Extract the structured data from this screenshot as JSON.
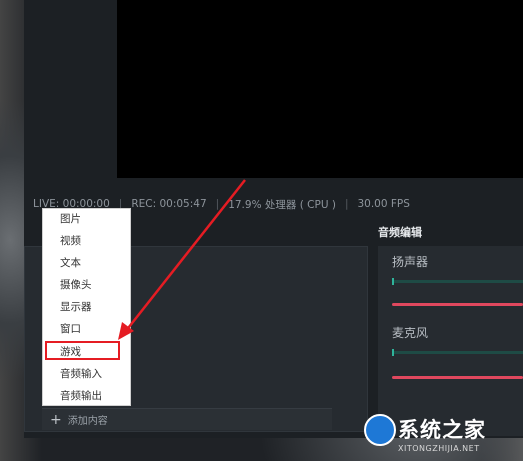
{
  "statusbar": {
    "live": "LIVE: 00:00:00",
    "rec": "REC: 00:05:47",
    "cpu": "17.9% 处理器 ( CPU )",
    "fps": "30.00 FPS"
  },
  "source_menu": {
    "items": [
      "图片",
      "视频",
      "文本",
      "摄像头",
      "显示器",
      "窗口",
      "游戏",
      "音频输入",
      "音频输出"
    ],
    "highlighted": "游戏"
  },
  "add_bar": {
    "icon": "plus-icon",
    "label": "添加内容"
  },
  "audio_panel": {
    "title": "音频编辑",
    "channels": [
      {
        "name": "扬声器"
      },
      {
        "name": "麦克风"
      }
    ]
  },
  "watermark": {
    "text": "系统之家",
    "sub": "XITONGZHIJIA.NET"
  },
  "colors": {
    "accent_red": "#e51c23",
    "slider_red": "#e0485e",
    "meter_green": "#2fb39a"
  }
}
